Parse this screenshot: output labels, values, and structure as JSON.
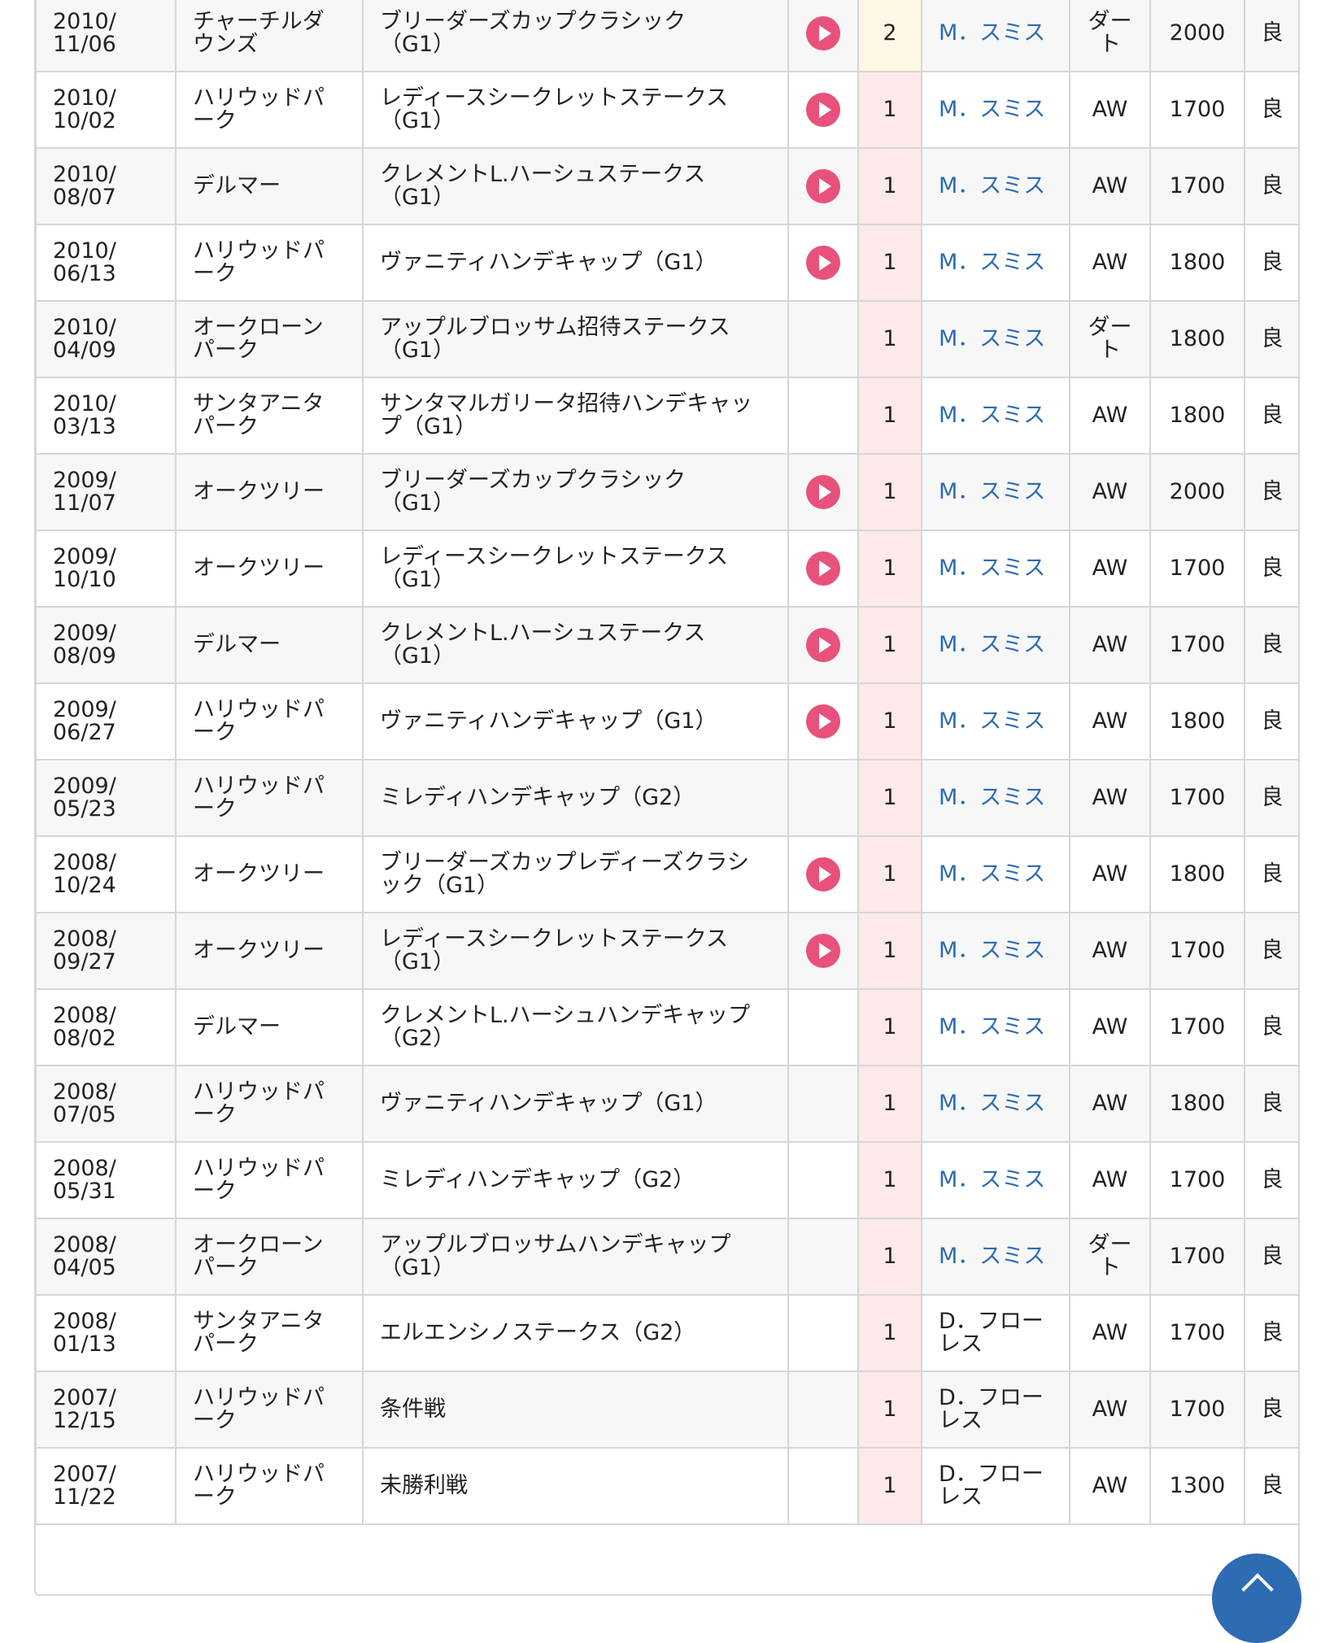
{
  "colors": {
    "jockey_link": "#2d6bb3",
    "video_button": "#e8517b",
    "rank_first_bg": "#fde9ea",
    "rank_second_bg": "#fdf8e4",
    "border": "#d6d6d6"
  },
  "icons": {
    "video": "play-icon",
    "scroll_top": "chevron-up-icon"
  },
  "race_results": [
    {
      "date": "2010/\n11/06",
      "venue": "チャーチルダ\nウンズ",
      "race": "ブリーダーズカップクラシック\n（G1）",
      "video": true,
      "rank": "2",
      "jockey": "M．スミス",
      "jockey_link": true,
      "surface": "ダー\nト",
      "distance": "2000",
      "condition": "良"
    },
    {
      "date": "2010/\n10/02",
      "venue": "ハリウッドパ\nーク",
      "race": "レディースシークレットステークス\n（G1）",
      "video": true,
      "rank": "1",
      "jockey": "M．スミス",
      "jockey_link": true,
      "surface": "AW",
      "distance": "1700",
      "condition": "良"
    },
    {
      "date": "2010/\n08/07",
      "venue": "デルマー",
      "race": "クレメントL.ハーシュステークス\n（G1）",
      "video": true,
      "rank": "1",
      "jockey": "M．スミス",
      "jockey_link": true,
      "surface": "AW",
      "distance": "1700",
      "condition": "良"
    },
    {
      "date": "2010/\n06/13",
      "venue": "ハリウッドパ\nーク",
      "race": "ヴァニティハンデキャップ（G1）",
      "video": true,
      "rank": "1",
      "jockey": "M．スミス",
      "jockey_link": true,
      "surface": "AW",
      "distance": "1800",
      "condition": "良"
    },
    {
      "date": "2010/\n04/09",
      "venue": "オークローン\nパーク",
      "race": "アップルブロッサム招待ステークス\n（G1）",
      "video": false,
      "rank": "1",
      "jockey": "M．スミス",
      "jockey_link": true,
      "surface": "ダー\nト",
      "distance": "1800",
      "condition": "良"
    },
    {
      "date": "2010/\n03/13",
      "venue": "サンタアニタ\nパーク",
      "race": "サンタマルガリータ招待ハンデキャッ\nプ（G1）",
      "video": false,
      "rank": "1",
      "jockey": "M．スミス",
      "jockey_link": true,
      "surface": "AW",
      "distance": "1800",
      "condition": "良"
    },
    {
      "date": "2009/\n11/07",
      "venue": "オークツリー",
      "race": "ブリーダーズカップクラシック\n（G1）",
      "video": true,
      "rank": "1",
      "jockey": "M．スミス",
      "jockey_link": true,
      "surface": "AW",
      "distance": "2000",
      "condition": "良"
    },
    {
      "date": "2009/\n10/10",
      "venue": "オークツリー",
      "race": "レディースシークレットステークス\n（G1）",
      "video": true,
      "rank": "1",
      "jockey": "M．スミス",
      "jockey_link": true,
      "surface": "AW",
      "distance": "1700",
      "condition": "良"
    },
    {
      "date": "2009/\n08/09",
      "venue": "デルマー",
      "race": "クレメントL.ハーシュステークス\n（G1）",
      "video": true,
      "rank": "1",
      "jockey": "M．スミス",
      "jockey_link": true,
      "surface": "AW",
      "distance": "1700",
      "condition": "良"
    },
    {
      "date": "2009/\n06/27",
      "venue": "ハリウッドパ\nーク",
      "race": "ヴァニティハンデキャップ（G1）",
      "video": true,
      "rank": "1",
      "jockey": "M．スミス",
      "jockey_link": true,
      "surface": "AW",
      "distance": "1800",
      "condition": "良"
    },
    {
      "date": "2009/\n05/23",
      "venue": "ハリウッドパ\nーク",
      "race": "ミレディハンデキャップ（G2）",
      "video": false,
      "rank": "1",
      "jockey": "M．スミス",
      "jockey_link": true,
      "surface": "AW",
      "distance": "1700",
      "condition": "良"
    },
    {
      "date": "2008/\n10/24",
      "venue": "オークツリー",
      "race": "ブリーダーズカップレディーズクラシ\nック（G1）",
      "video": true,
      "rank": "1",
      "jockey": "M．スミス",
      "jockey_link": true,
      "surface": "AW",
      "distance": "1800",
      "condition": "良"
    },
    {
      "date": "2008/\n09/27",
      "venue": "オークツリー",
      "race": "レディースシークレットステークス\n（G1）",
      "video": true,
      "rank": "1",
      "jockey": "M．スミス",
      "jockey_link": true,
      "surface": "AW",
      "distance": "1700",
      "condition": "良"
    },
    {
      "date": "2008/\n08/02",
      "venue": "デルマー",
      "race": "クレメントL.ハーシュハンデキャップ\n（G2）",
      "video": false,
      "rank": "1",
      "jockey": "M．スミス",
      "jockey_link": true,
      "surface": "AW",
      "distance": "1700",
      "condition": "良"
    },
    {
      "date": "2008/\n07/05",
      "venue": "ハリウッドパ\nーク",
      "race": "ヴァニティハンデキャップ（G1）",
      "video": false,
      "rank": "1",
      "jockey": "M．スミス",
      "jockey_link": true,
      "surface": "AW",
      "distance": "1800",
      "condition": "良"
    },
    {
      "date": "2008/\n05/31",
      "venue": "ハリウッドパ\nーク",
      "race": "ミレディハンデキャップ（G2）",
      "video": false,
      "rank": "1",
      "jockey": "M．スミス",
      "jockey_link": true,
      "surface": "AW",
      "distance": "1700",
      "condition": "良"
    },
    {
      "date": "2008/\n04/05",
      "venue": "オークローン\nパーク",
      "race": "アップルブロッサムハンデキャップ\n（G1）",
      "video": false,
      "rank": "1",
      "jockey": "M．スミス",
      "jockey_link": true,
      "surface": "ダー\nト",
      "distance": "1700",
      "condition": "良"
    },
    {
      "date": "2008/\n01/13",
      "venue": "サンタアニタ\nパーク",
      "race": "エルエンシノステークス（G2）",
      "video": false,
      "rank": "1",
      "jockey": "D．フロー\nレス",
      "jockey_link": false,
      "surface": "AW",
      "distance": "1700",
      "condition": "良"
    },
    {
      "date": "2007/\n12/15",
      "venue": "ハリウッドパ\nーク",
      "race": "条件戦",
      "video": false,
      "rank": "1",
      "jockey": "D．フロー\nレス",
      "jockey_link": false,
      "surface": "AW",
      "distance": "1700",
      "condition": "良"
    },
    {
      "date": "2007/\n11/22",
      "venue": "ハリウッドパ\nーク",
      "race": "未勝利戦",
      "video": false,
      "rank": "1",
      "jockey": "D．フロー\nレス",
      "jockey_link": false,
      "surface": "AW",
      "distance": "1300",
      "condition": "良"
    }
  ]
}
